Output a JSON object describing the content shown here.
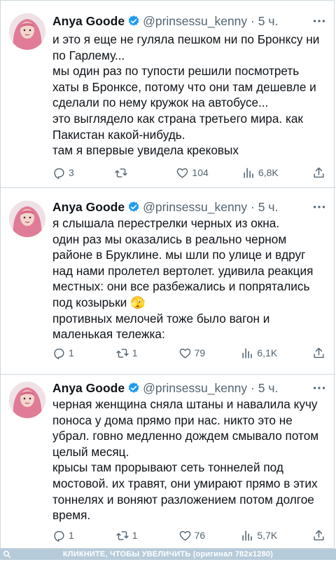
{
  "tweets": [
    {
      "author": "Anya Goode",
      "handle": "@prinsessu_kenny",
      "time": "· 5 ч.",
      "lines": [
        "и это я еще не гуляла пешком ни по Бронксу ни по Гарлему...",
        "мы один раз по тупости решили посмотреть хаты в Бронксе, потому что они там дешевле и сделали по нему кружок на автобусе...",
        "это выглядело как страна третьего мира. как Пакистан какой-нибудь.",
        "там я впервые увидела крековых"
      ],
      "replies": "3",
      "reposts": "",
      "likes": "104",
      "views": "6,8K"
    },
    {
      "author": "Anya Goode",
      "handle": "@prinsessu_kenny",
      "time": "· 5 ч.",
      "lines": [
        "я слышала перестрелки черных из окна.",
        "один раз мы оказались в реально черном районе в Бруклине. мы шли по улице и вдруг над нами пролетел вертолет. удивила реакция местных: они все разбежались и попрятались под козырьки 🫣",
        "противных мелочей тоже было вагон и маленькая тележка:"
      ],
      "replies": "1",
      "reposts": "1",
      "likes": "79",
      "views": "6,1K"
    },
    {
      "author": "Anya Goode",
      "handle": "@prinsessu_kenny",
      "time": "· 5 ч.",
      "lines": [
        "черная женщина сняла штаны и навалила кучу поноса у дома прямо при нас. никто это не убрал. говно медленно дождем смывало потом целый месяц.",
        "крысы там прорывают сеть тоннелей под мостовой. их травят, они умирают прямо в этих тоннелях и воняют разложением потом долгое время."
      ],
      "replies": "1",
      "reposts": "1",
      "likes": "76",
      "views": "5,7K"
    }
  ],
  "footer": {
    "text": "КЛИКНИТЕ, ЧТОБЫ УВЕЛИЧИТЬ (оригинал 782x1280)"
  },
  "colors": {
    "text": "#0f1419",
    "muted": "#536471",
    "verified": "#1d9bf0",
    "divider": "#cfd9de",
    "footer_bg": "#b6cbd9"
  },
  "icons": [
    "verified-badge-icon",
    "more-icon",
    "reply-icon",
    "repost-icon",
    "like-icon",
    "views-icon",
    "share-icon",
    "zoom-icon"
  ]
}
